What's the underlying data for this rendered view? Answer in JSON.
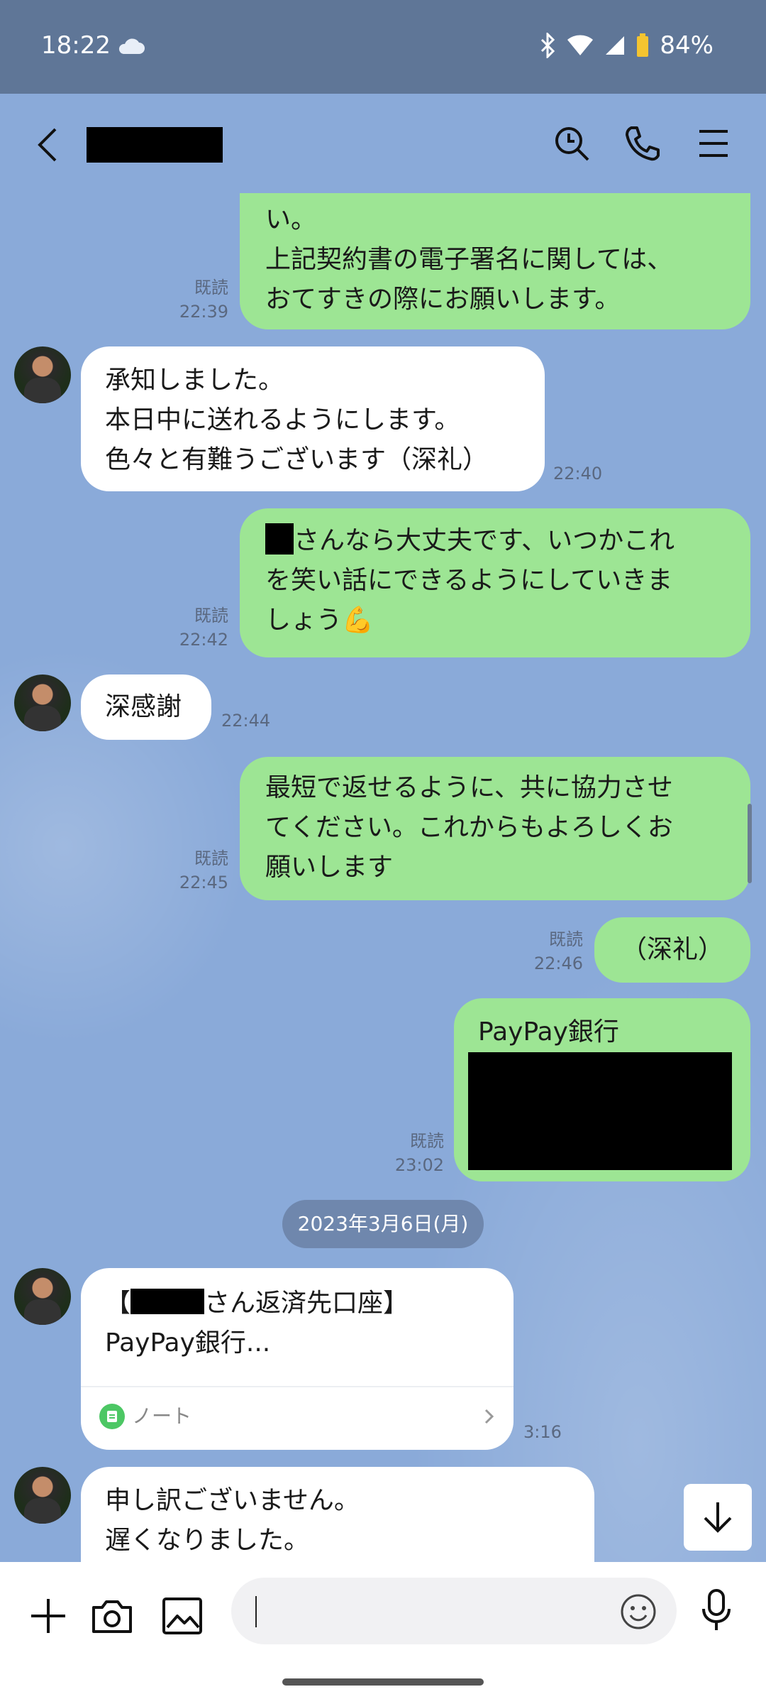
{
  "status": {
    "time": "18:22",
    "battery": "84%"
  },
  "messages": {
    "m1": {
      "lines": [
        "い。",
        "上記契約書の電子署名に関しては、",
        "おてすきの際にお願いします。"
      ],
      "read": "既読",
      "time": "22:39"
    },
    "m2": {
      "lines": [
        "承知しました。",
        "本日中に送れるようにします。",
        "色々と有難うございます（深礼）"
      ],
      "time": "22:40"
    },
    "m3": {
      "lines": [
        "さんなら大丈夫です、いつかこれ",
        "を笑い話にできるようにしていきま",
        "しょう"
      ],
      "emoji": "💪",
      "read": "既読",
      "time": "22:42"
    },
    "m4": {
      "text": "深感謝",
      "time": "22:44"
    },
    "m5": {
      "lines": [
        "最短で返せるように、共に協力させ",
        "てください。これからもよろしくお",
        "願いします"
      ],
      "read": "既読",
      "time": "22:45"
    },
    "m6": {
      "text": "（深礼）",
      "read": "既読",
      "time": "22:46"
    },
    "m7": {
      "title": "PayPay銀行",
      "read": "既読",
      "time": "23:02"
    },
    "m8": {
      "line1_prefix": "【",
      "line1_suffix": "さん返済先口座】",
      "line2": "PayPay銀行...",
      "note_label": "ノート",
      "time": "3:16"
    },
    "m9": {
      "lines": [
        "申し訳ございません。",
        "遅くなりました。"
      ]
    }
  },
  "date_divider": "2023年3月6日(月)",
  "icons": [
    "back-icon",
    "search-icon",
    "phone-icon",
    "menu-icon",
    "plus-icon",
    "camera-icon",
    "image-icon",
    "emoji-icon",
    "mic-icon",
    "arrow-down-icon",
    "note-icon",
    "chevron-right-icon"
  ]
}
